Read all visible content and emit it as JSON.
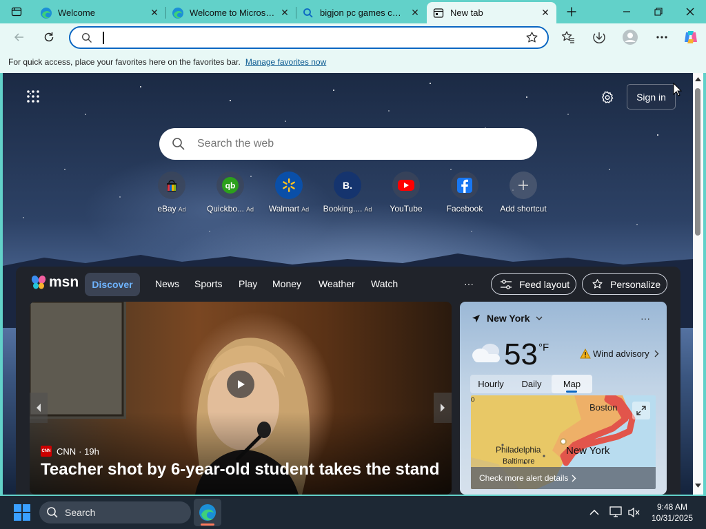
{
  "tabs": [
    {
      "title": "Welcome",
      "icon": "edge-icon"
    },
    {
      "title": "Welcome to Microsoft E",
      "icon": "edge-icon"
    },
    {
      "title": "bigjon pc games collect",
      "icon": "search-icon"
    },
    {
      "title": "New tab",
      "icon": "newtab-icon",
      "active": true
    }
  ],
  "address": {
    "value": "",
    "placeholder": ""
  },
  "favorites_bar": {
    "text": "For quick access, place your favorites here on the favorites bar.",
    "link": "Manage favorites now"
  },
  "page": {
    "sign_in": "Sign in",
    "search_placeholder": "Search the web",
    "shortcuts": [
      {
        "label": "eBay",
        "ad": "Ad",
        "icon": "ebay-icon"
      },
      {
        "label": "Quickbo...",
        "ad": "Ad",
        "icon": "quickbooks-icon"
      },
      {
        "label": "Walmart",
        "ad": "Ad",
        "icon": "walmart-icon"
      },
      {
        "label": "Booking....",
        "ad": "Ad",
        "icon": "booking-icon"
      },
      {
        "label": "YouTube",
        "ad": "",
        "icon": "youtube-icon"
      },
      {
        "label": "Facebook",
        "ad": "",
        "icon": "facebook-icon"
      },
      {
        "label": "Add shortcut",
        "ad": "",
        "icon": "plus-icon"
      }
    ]
  },
  "msn": {
    "logo": "msn",
    "nav": [
      "Discover",
      "News",
      "Sports",
      "Play",
      "Money",
      "Weather",
      "Watch"
    ],
    "more": "···",
    "feed_layout": "Feed layout",
    "personalize": "Personalize"
  },
  "story": {
    "source": "CNN",
    "age": "· 19h",
    "headline": "Teacher shot by 6-year-old student takes the stand"
  },
  "weather": {
    "location": "New York",
    "temp": "53",
    "unit": "°F",
    "alert": "Wind advisory",
    "tabs": [
      "Hourly",
      "Daily",
      "Map"
    ],
    "active_tab": "Map",
    "map_labels": [
      "Boston",
      "Philadelphia",
      "Baltimore",
      "New York"
    ],
    "more_link": "Check more alert details"
  },
  "taskbar": {
    "search": "Search",
    "time": "9:48 AM",
    "date": "10/31/2025"
  },
  "colors": {
    "accent": "#0a66c2",
    "tabstrip": "#62d1c9",
    "panel": "#20232a"
  }
}
